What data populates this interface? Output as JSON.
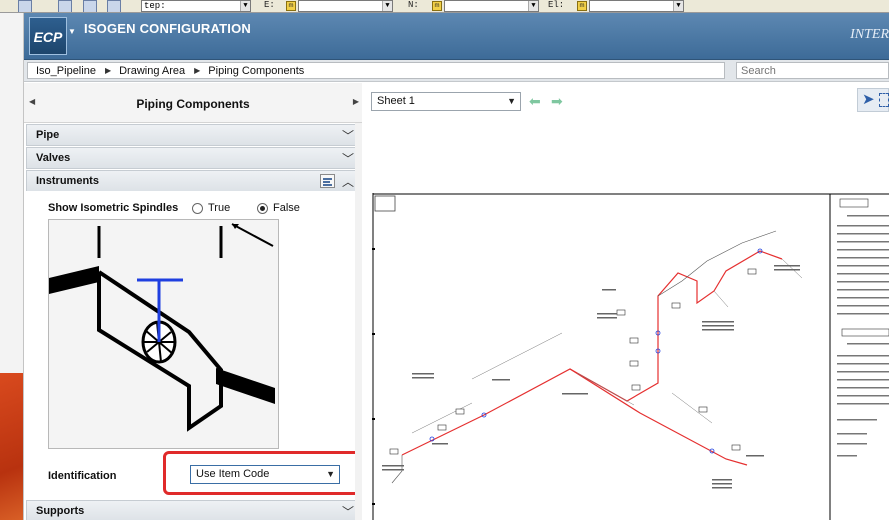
{
  "toolbar": {
    "field1": "tep:",
    "label_e": "E:",
    "label_n": "N:",
    "label_el": "El:",
    "chip_text": "m"
  },
  "header": {
    "logo": "ECP",
    "title": "ISOGEN CONFIGURATION",
    "brand": "INTER"
  },
  "breadcrumb": [
    "Iso_Pipeline",
    "Drawing Area",
    "Piping Components"
  ],
  "search": {
    "placeholder": "Search"
  },
  "panel": {
    "title": "Piping Components",
    "sections": {
      "pipe": "Pipe",
      "valves": "Valves",
      "instruments": "Instruments",
      "supports": "Supports"
    },
    "instruments": {
      "spindle_label": "Show Isometric Spindles",
      "option_true": "True",
      "option_false": "False",
      "selected": "False",
      "identification_label": "Identification",
      "identification_value": "Use Item Code"
    }
  },
  "drawing": {
    "sheet_select": "Sheet 1"
  },
  "colors": {
    "header": "#4a77a3",
    "highlight": "#e02a2a",
    "pipe_red": "#e53030",
    "spindle_blue": "#1f3fe0"
  }
}
